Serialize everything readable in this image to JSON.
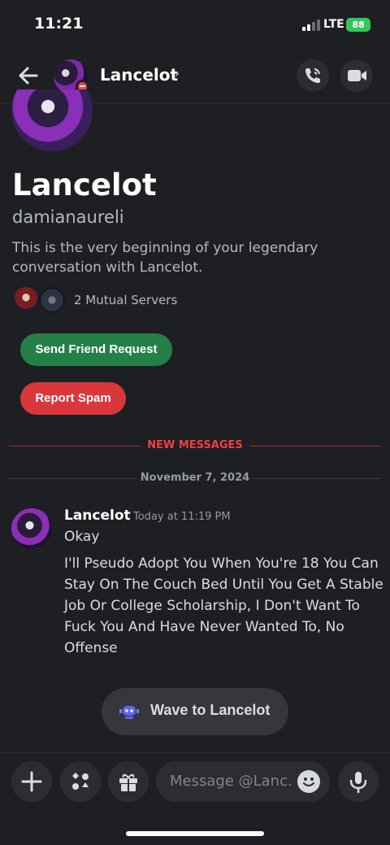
{
  "status_bar": {
    "time": "11:21",
    "network": "LTE",
    "battery": "88"
  },
  "header": {
    "title": "Lancelot",
    "chevron": "›",
    "icons": [
      "back-arrow-icon",
      "phone-call-icon",
      "video-camera-icon"
    ]
  },
  "profile": {
    "display_name": "Lancelot",
    "username": "damianaureli",
    "intro": "This is the very beginning of your legendary conversation with Lancelot.",
    "mutual_servers": "2 Mutual Servers"
  },
  "actions": {
    "friend_request": "Send Friend Request",
    "report_spam": "Report Spam"
  },
  "dividers": {
    "new_messages": "NEW MESSAGES",
    "date": "November 7, 2024"
  },
  "message": {
    "author": "Lancelot",
    "timestamp": "Today at 11:19 PM",
    "line1": "Okay",
    "line2": "I'll Pseudo Adopt You When You're 18 You Can Stay On The Couch Bed Until You Get A Stable Job Or College Scholarship, I Don't Want To Fuck You And Have Never Wanted To, No Offense"
  },
  "wave": {
    "label": "Wave to Lancelot"
  },
  "composer": {
    "placeholder": "Message @Lanc...",
    "icons": [
      "plus-icon",
      "apps-icon",
      "gift-icon",
      "emoji-icon",
      "microphone-icon"
    ]
  },
  "colors": {
    "background": "#1e1f23",
    "friend_button": "#248046",
    "spam_button": "#da373c",
    "new_messages": "#f23f43",
    "battery": "#34c759"
  }
}
